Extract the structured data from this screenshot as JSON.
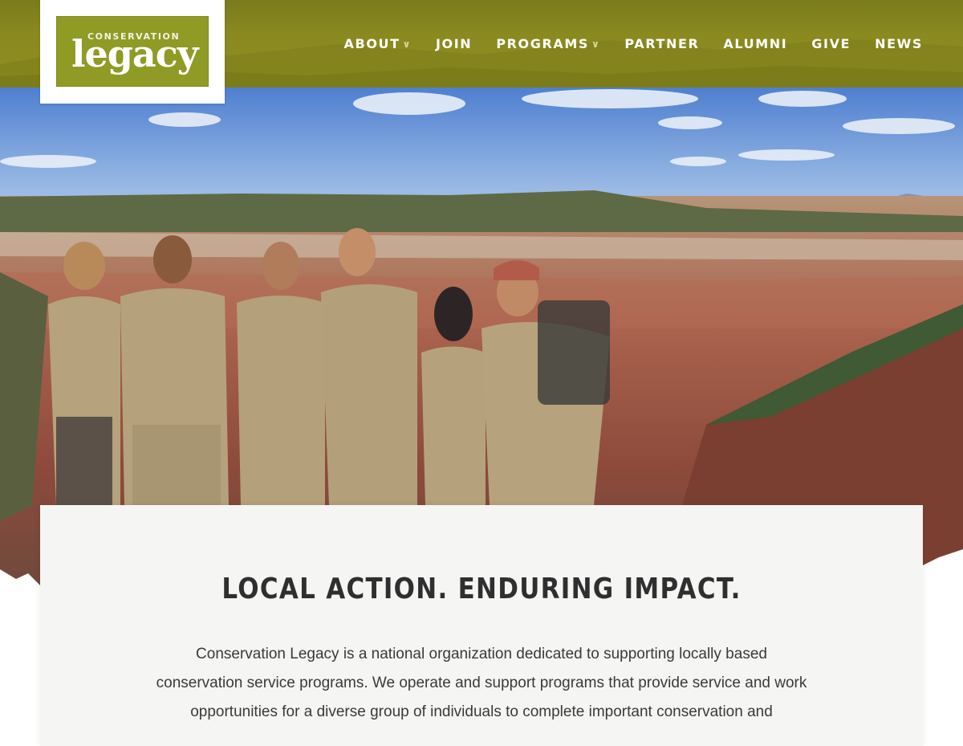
{
  "logo": {
    "top_text": "CONSERVATION",
    "main_text": "legacy"
  },
  "nav": {
    "items": [
      {
        "label": "ABOUT",
        "has_dropdown": true
      },
      {
        "label": "JOIN",
        "has_dropdown": false
      },
      {
        "label": "PROGRAMS",
        "has_dropdown": true
      },
      {
        "label": "PARTNER",
        "has_dropdown": false
      },
      {
        "label": "ALUMNI",
        "has_dropdown": false
      },
      {
        "label": "GIVE",
        "has_dropdown": false
      },
      {
        "label": "NEWS",
        "has_dropdown": false
      }
    ],
    "caret": "∨"
  },
  "hero": {
    "image_subject": "Conservation corps crew members standing on a canyon rim"
  },
  "main": {
    "headline": "LOCAL ACTION. ENDURING IMPACT.",
    "intro_lines": [
      "Conservation Legacy is a national organization dedicated to supporting locally based",
      "conservation service programs. We operate and support programs that provide service and work",
      "opportunities for a diverse group of individuals to complete important conservation and"
    ]
  },
  "colors": {
    "header_olive": "#8a8a20",
    "logo_green": "#8f9b25",
    "card_bg": "#f5f5f4",
    "headline": "#2f2f2f"
  }
}
